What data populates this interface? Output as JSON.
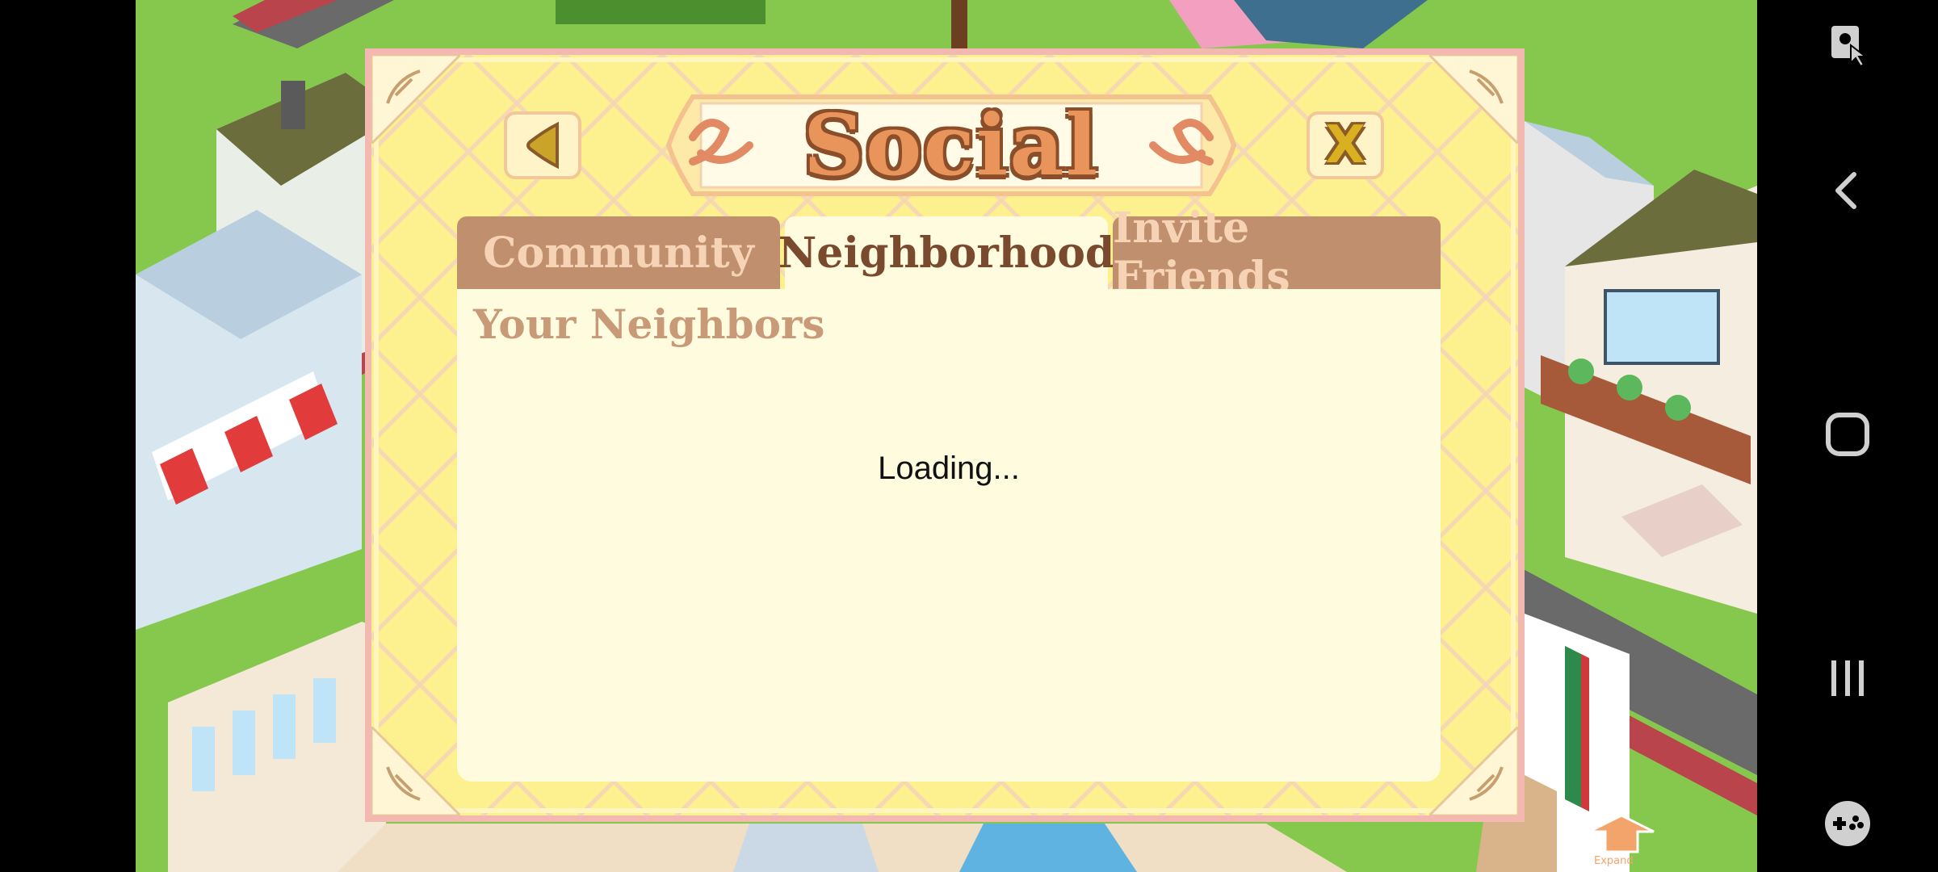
{
  "dialog": {
    "title": "Social",
    "back_icon": "triangle-left-icon",
    "close_label": "X",
    "tabs": [
      {
        "label": "Community",
        "active": false
      },
      {
        "label": "Neighborhood",
        "active": true
      },
      {
        "label": "Invite Friends",
        "active": false
      }
    ],
    "section_title": "Your Neighbors",
    "status": "Loading..."
  },
  "scene": {
    "expand_label": "Expand"
  },
  "navbar": {
    "icons": [
      "game-tools-icon",
      "back-icon",
      "home-icon",
      "recents-icon",
      "gamepad-icon"
    ]
  },
  "colors": {
    "dialog_bg": "#fdf08e",
    "dialog_border": "#f3b8b0",
    "tab_inactive": "#c0906e",
    "tab_active": "#fffbdf",
    "title_fill": "#e8945a",
    "title_outline": "#8a4f2a"
  }
}
